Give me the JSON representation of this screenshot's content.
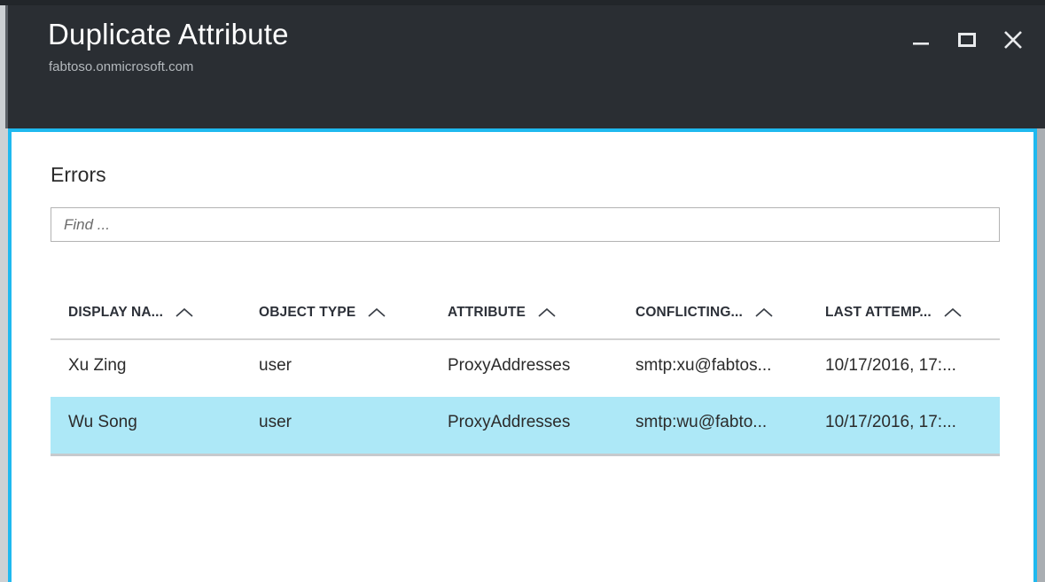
{
  "window": {
    "title": "Duplicate Attribute",
    "subtitle": "fabtoso.onmicrosoft.com",
    "controls": {
      "minimize": "minimize-icon",
      "maximize": "maximize-icon",
      "close": "close-icon"
    },
    "accent_color": "#1fb9ef",
    "titlebar_color": "#2a2e33"
  },
  "panel": {
    "heading": "Errors",
    "search": {
      "placeholder": "Find ...",
      "value": ""
    },
    "table": {
      "sort_icon": "chevron-up-icon",
      "selection_color": "#ade8f7",
      "columns": [
        {
          "label": "DISPLAY NA...",
          "sortable": true
        },
        {
          "label": "OBJECT TYPE",
          "sortable": true
        },
        {
          "label": "ATTRIBUTE",
          "sortable": true
        },
        {
          "label": "CONFLICTING...",
          "sortable": true
        },
        {
          "label": "LAST ATTEMP...",
          "sortable": true
        }
      ],
      "rows": [
        {
          "display_name": "Xu Zing",
          "object_type": "user",
          "attribute": "ProxyAddresses",
          "conflicting_value": "smtp:xu@fabtos...",
          "last_attempt": "10/17/2016, 17:...",
          "selected": false
        },
        {
          "display_name": "Wu Song",
          "object_type": "user",
          "attribute": "ProxyAddresses",
          "conflicting_value": "smtp:wu@fabto...",
          "last_attempt": "10/17/2016, 17:...",
          "selected": true
        }
      ]
    }
  }
}
